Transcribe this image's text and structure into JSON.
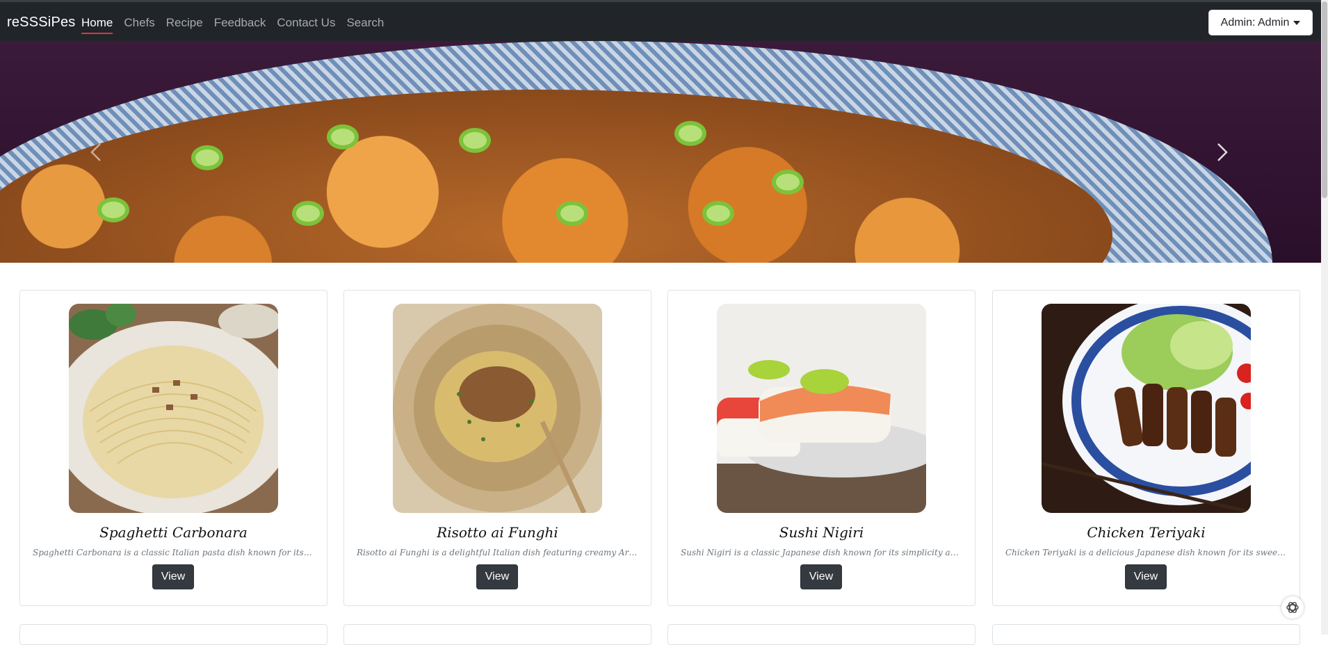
{
  "navbar": {
    "brand": "reSSSiPes",
    "links": [
      "Home",
      "Chefs",
      "Recipe",
      "Feedback",
      "Contact Us",
      "Search"
    ],
    "active_link": "Home",
    "user_menu": "Admin: Admin"
  },
  "carousel": {
    "image": "mapo-tofu-with-scallions",
    "prev_icon": "chevron-left-icon",
    "next_icon": "chevron-right-icon"
  },
  "recipes": [
    {
      "title": "Spaghetti Carbonara",
      "description": "Spaghetti Carbonara is a classic Italian pasta dish known for its creamy ...",
      "button": "View"
    },
    {
      "title": "Risotto ai Funghi",
      "description": "Risotto ai Funghi is a delightful Italian dish featuring creamy Arborio ri...",
      "button": "View"
    },
    {
      "title": "Sushi Nigiri",
      "description": "Sushi Nigiri is a classic Japanese dish known for its simplicity and the ha...",
      "button": "View"
    },
    {
      "title": "Chicken Teriyaki",
      "description": "Chicken Teriyaki is a delicious Japanese dish known for its sweet and sav...",
      "button": "View"
    }
  ],
  "colors": {
    "navbar_bg": "#212529",
    "active_underline": "#dc3545",
    "button_bg": "#343a40"
  }
}
